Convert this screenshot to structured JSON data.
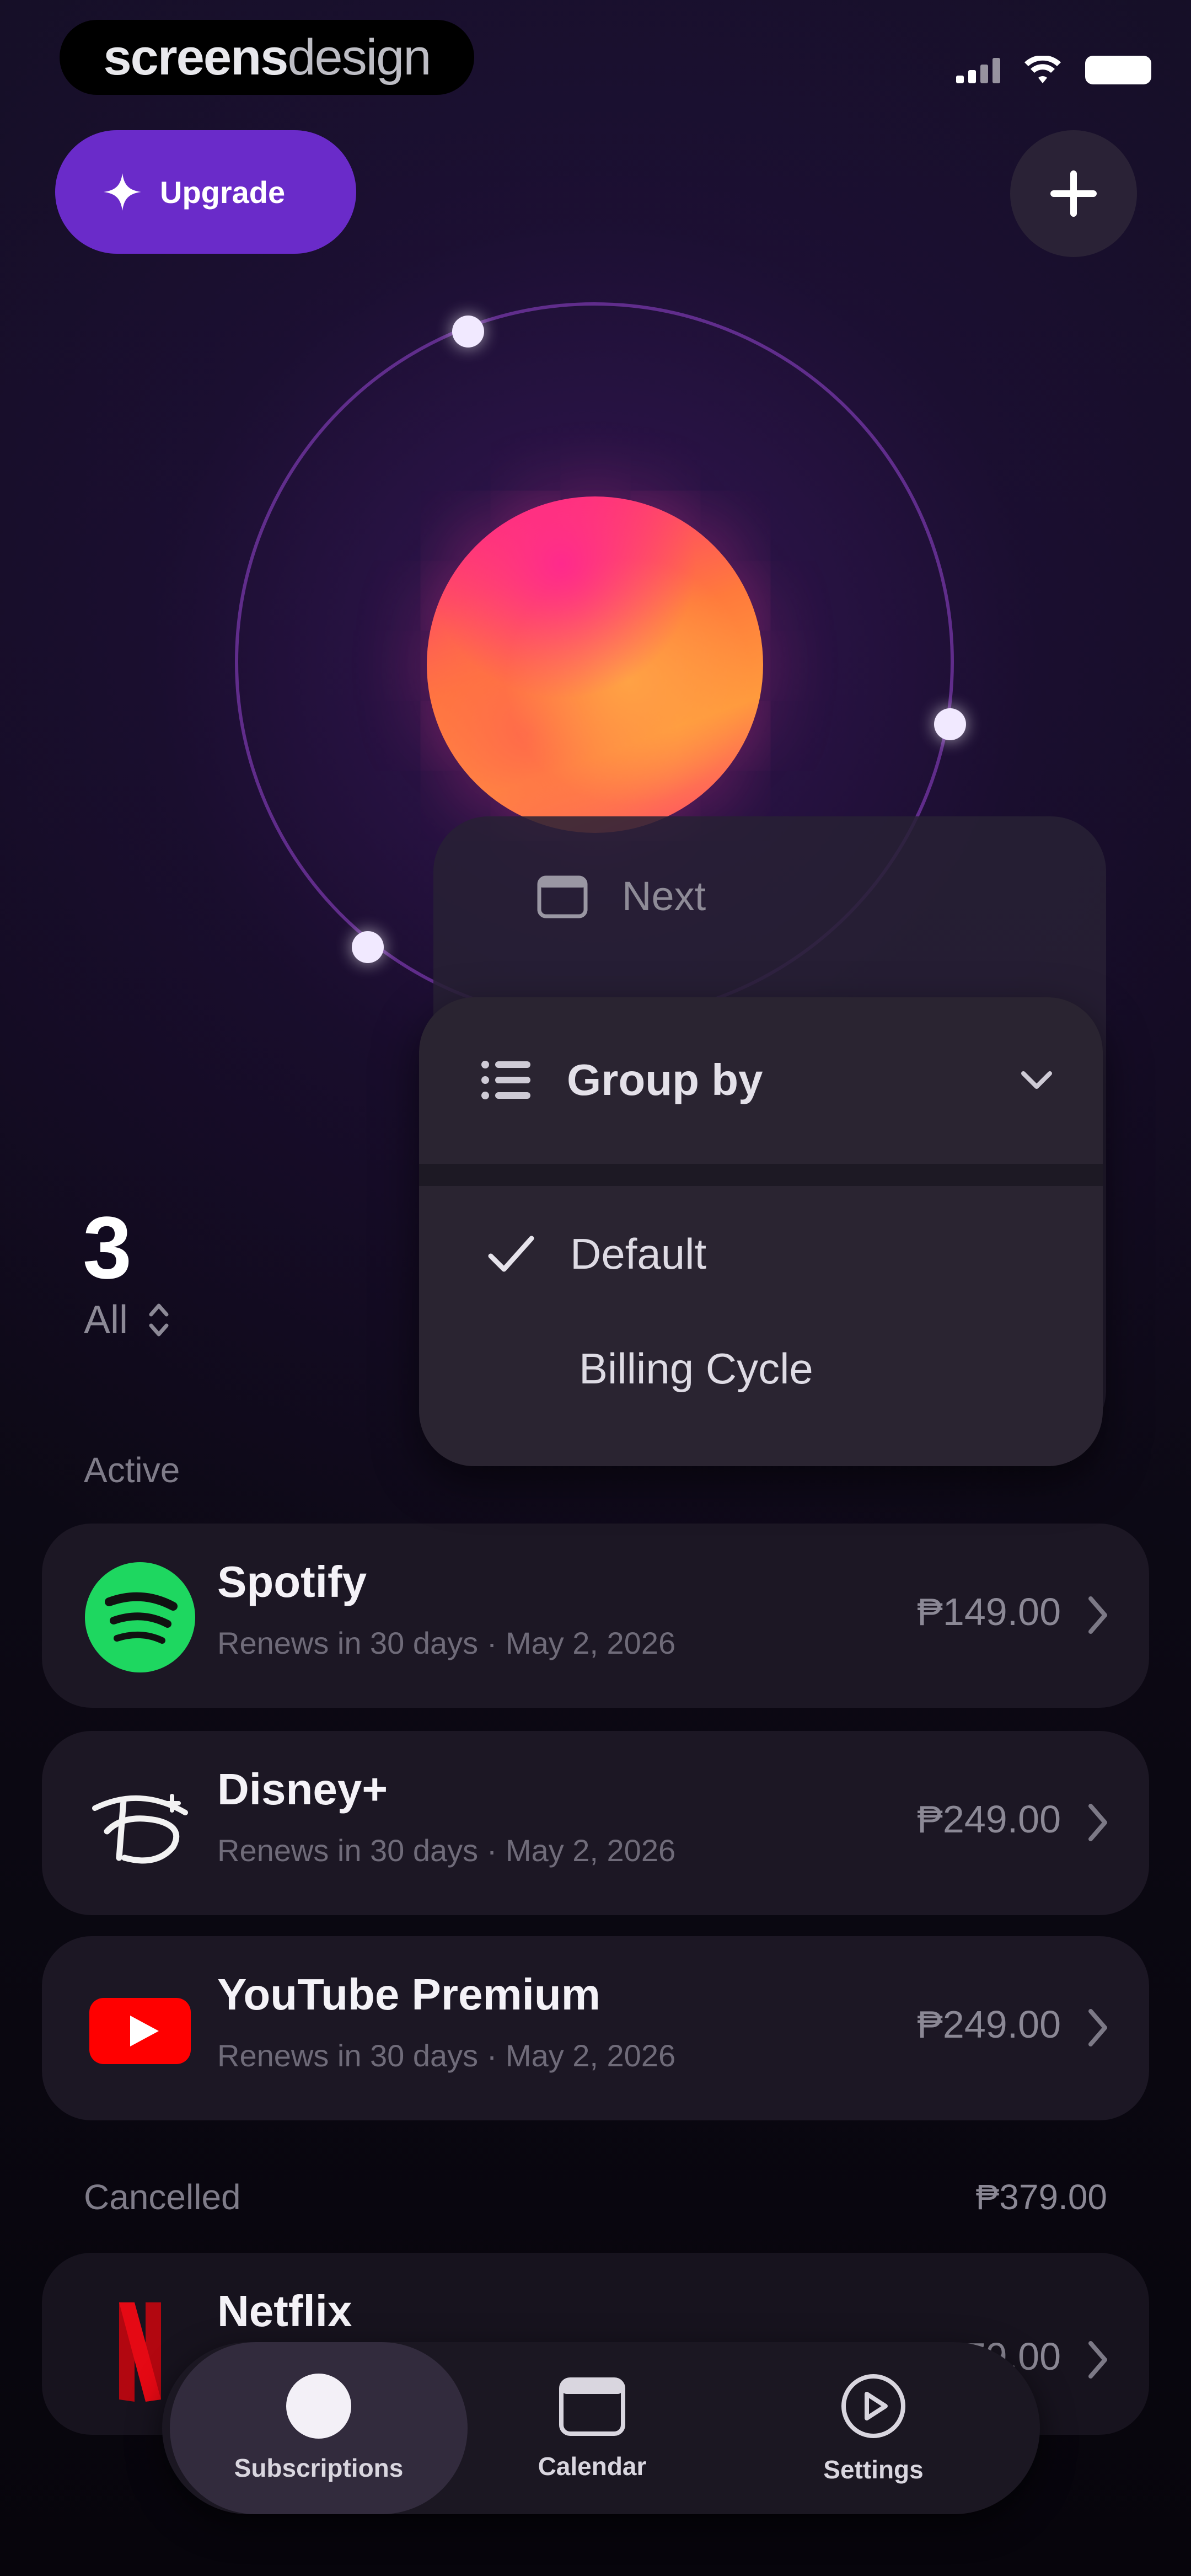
{
  "watermark": {
    "bold": "screens",
    "light": "design"
  },
  "header": {
    "upgrade_label": "Upgrade"
  },
  "summary": {
    "count": "3",
    "filter_label": "All"
  },
  "sort_menu": {
    "next_label": "Next"
  },
  "group_menu": {
    "title": "Group by",
    "options": [
      {
        "label": "Default",
        "selected": true
      },
      {
        "label": "Billing Cycle",
        "selected": false
      }
    ]
  },
  "sections": {
    "active_label": "Active",
    "cancelled_label": "Cancelled",
    "cancelled_total": "₱379.00"
  },
  "subscriptions": [
    {
      "name": "Spotify",
      "subtitle": "Renews in 30 days · May 2, 2026",
      "price": "₱149.00",
      "icon": "spotify-logo"
    },
    {
      "name": "Disney+",
      "subtitle": "Renews in 30 days · May 2, 2026",
      "price": "₱249.00",
      "icon": "disney-logo"
    },
    {
      "name": "YouTube Premium",
      "subtitle": "Renews in 30 days · May 2, 2026",
      "price": "₱249.00",
      "icon": "youtube-logo"
    },
    {
      "name": "Netflix",
      "subtitle": "",
      "price": "₱379.00",
      "icon": "netflix-logo"
    }
  ],
  "tabs": [
    {
      "label": "Subscriptions",
      "icon": "circle-icon",
      "active": true
    },
    {
      "label": "Calendar",
      "icon": "calendar-icon",
      "active": false
    },
    {
      "label": "Settings",
      "icon": "settings-icon",
      "active": false
    }
  ],
  "colors": {
    "accent": "#6a2bc9",
    "background": "#0d0a17",
    "card": "#1c1724",
    "spotify": "#1ed760",
    "youtube": "#ff0000",
    "netflix": "#d0121b"
  }
}
